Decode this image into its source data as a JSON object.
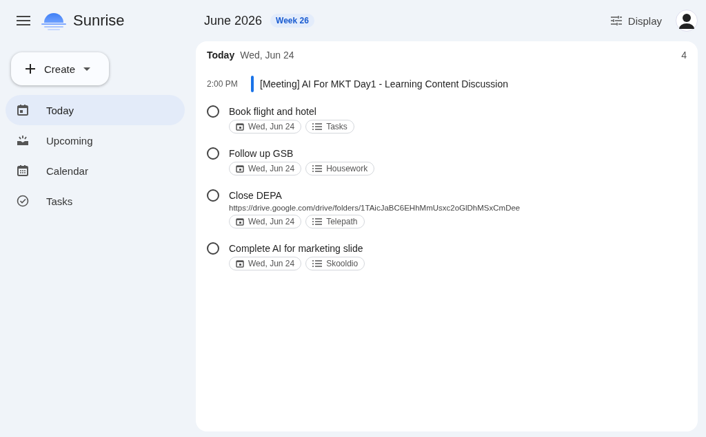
{
  "app": {
    "name": "Sunrise"
  },
  "header": {
    "month": "June 2026",
    "week": "Week 26",
    "display": "Display"
  },
  "create": {
    "label": "Create"
  },
  "sidebar": {
    "items": [
      {
        "kind": "today",
        "label": "Today",
        "selected": true
      },
      {
        "kind": "upcoming",
        "label": "Upcoming",
        "selected": false
      },
      {
        "kind": "calendar",
        "label": "Calendar",
        "selected": false
      },
      {
        "kind": "tasks",
        "label": "Tasks",
        "selected": false
      }
    ]
  },
  "day": {
    "title": "Today",
    "date": "Wed, Jun 24",
    "count": "4"
  },
  "events": [
    {
      "time": "2:00 PM",
      "title": "[Meeting] AI For MKT Day1 - Learning Content Discussion",
      "color": "#1a73e8"
    }
  ],
  "tasks": [
    {
      "title": "Book flight and hotel",
      "checked": false,
      "date": "Wed, Jun 24",
      "list": "Tasks"
    },
    {
      "title": "Follow up GSB",
      "checked": false,
      "date": "Wed, Jun 24",
      "list": "Housework"
    },
    {
      "title": "Close DEPA",
      "checked": false,
      "note": "https://drive.google.com/drive/folders/1TAicJaBC6EHhMmUsxc2oGlDhMSxCmDee",
      "date": "Wed, Jun 24",
      "list": "Telepath"
    },
    {
      "title": "Complete AI for marketing slide",
      "checked": false,
      "date": "Wed, Jun 24",
      "list": "Skooldio"
    }
  ]
}
